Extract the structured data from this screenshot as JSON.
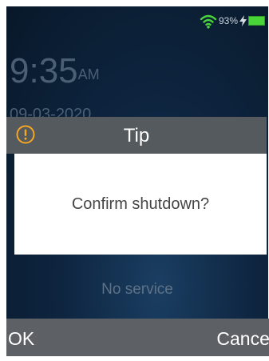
{
  "status": {
    "battery_percent": "93%",
    "wifi_icon": "wifi-icon",
    "charging_icon": "lightning-bolt-icon",
    "battery_color": "#49d43a",
    "wifi_color": "#49d43a"
  },
  "lockscreen": {
    "time": "9:35",
    "ampm": "AM",
    "date": "09-03-2020",
    "network": "No service"
  },
  "dialog": {
    "title": "Tip",
    "icon": "warning-icon",
    "icon_color": "#f5a623",
    "message": "Confirm shutdown?"
  },
  "softkeys": {
    "left": "OK",
    "right": "Cancel"
  }
}
